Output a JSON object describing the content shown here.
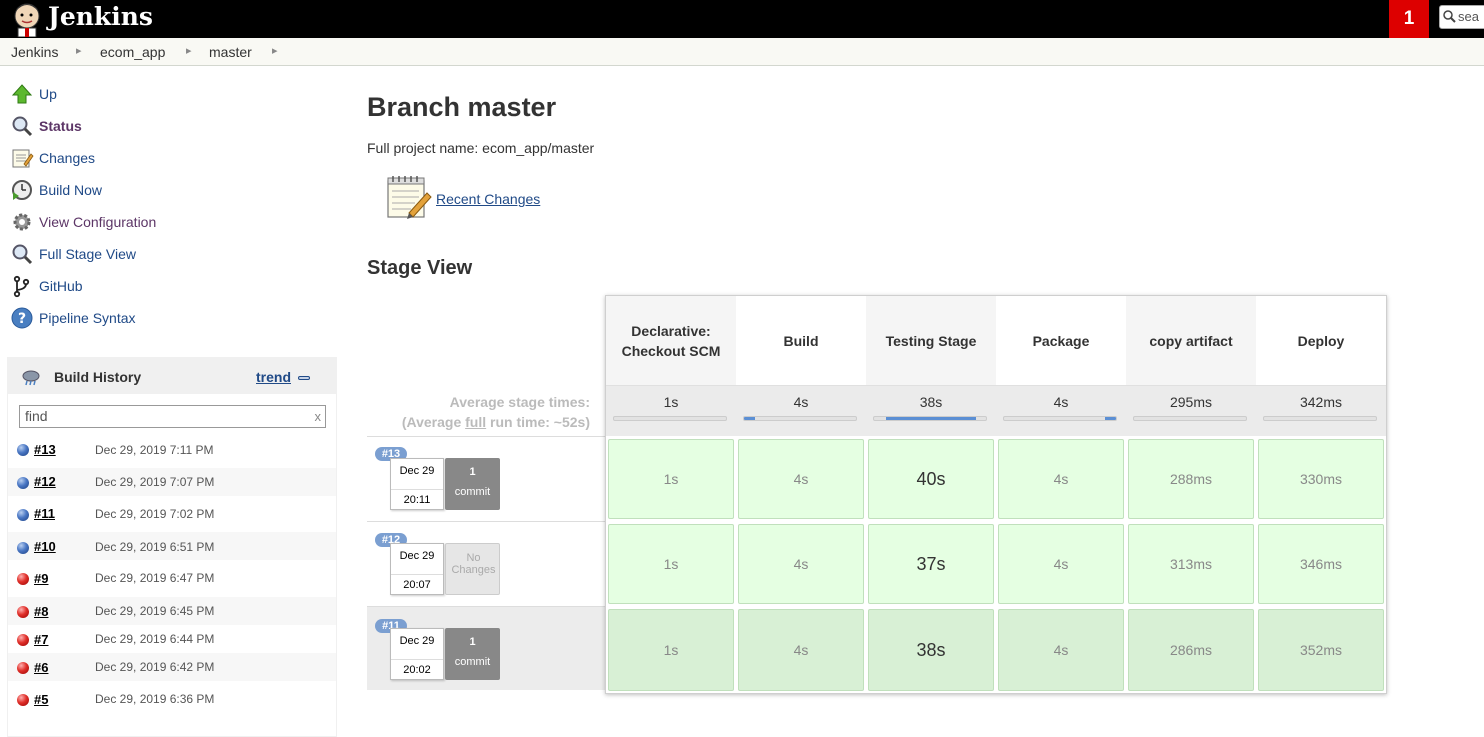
{
  "header": {
    "brand": "Jenkins",
    "notification_count": "1",
    "search_placeholder": "sea"
  },
  "breadcrumb": [
    "Jenkins",
    "ecom_app",
    "master"
  ],
  "sidebar": {
    "tasks": [
      {
        "label": "Up",
        "icon": "up-arrow-icon"
      },
      {
        "label": "Status",
        "icon": "magnifier-icon"
      },
      {
        "label": "Changes",
        "icon": "notepad-icon"
      },
      {
        "label": "Build Now",
        "icon": "clock-play-icon"
      },
      {
        "label": "View Configuration",
        "icon": "gear-icon"
      },
      {
        "label": "Full Stage View",
        "icon": "magnifier-icon"
      },
      {
        "label": "GitHub",
        "icon": "branch-icon"
      },
      {
        "label": "Pipeline Syntax",
        "icon": "help-icon"
      }
    ]
  },
  "build_history": {
    "title": "Build History",
    "trend": "trend",
    "find_placeholder": "find",
    "clear": "x",
    "rows": [
      {
        "num": "#13",
        "date": "Dec 29, 2019 7:11 PM",
        "status": "blue"
      },
      {
        "num": "#12",
        "date": "Dec 29, 2019 7:07 PM",
        "status": "blue"
      },
      {
        "num": "#11",
        "date": "Dec 29, 2019 7:02 PM",
        "status": "blue"
      },
      {
        "num": "#10",
        "date": "Dec 29, 2019 6:51 PM",
        "status": "blue"
      },
      {
        "num": "#9",
        "date": "Dec 29, 2019 6:47 PM",
        "status": "red"
      },
      {
        "num": "#8",
        "date": "Dec 29, 2019 6:45 PM",
        "status": "red"
      },
      {
        "num": "#7",
        "date": "Dec 29, 2019 6:44 PM",
        "status": "red"
      },
      {
        "num": "#6",
        "date": "Dec 29, 2019 6:42 PM",
        "status": "red"
      },
      {
        "num": "#5",
        "date": "Dec 29, 2019 6:36 PM",
        "status": "red"
      }
    ]
  },
  "main": {
    "title": "Branch master",
    "full_name": "Full project name: ecom_app/master",
    "recent_changes": "Recent Changes",
    "stage_view_title": "Stage View"
  },
  "stage_view": {
    "avg_label_1": "Average stage times:",
    "avg_label_2a": "(Average ",
    "avg_label_2b": "full",
    "avg_label_2c": " run time: ~52s)",
    "stages": [
      {
        "name": "Declarative: Checkout SCM",
        "avg": "1s",
        "avg_fraction": 0.0
      },
      {
        "name": "Build",
        "avg": "4s",
        "avg_fraction": 0.1
      },
      {
        "name": "Testing Stage",
        "avg": "38s",
        "avg_fraction": 0.8
      },
      {
        "name": "Package",
        "avg": "4s",
        "avg_fraction": 0.1
      },
      {
        "name": "copy artifact",
        "avg": "295ms",
        "avg_fraction": 0.0
      },
      {
        "name": "Deploy",
        "avg": "342ms",
        "avg_fraction": 0.0
      }
    ],
    "builds": [
      {
        "badge": "#13",
        "date": "Dec 29",
        "time": "20:11",
        "commit_count": "1",
        "commit_label": "commit",
        "no_changes": false,
        "durations": [
          "1s",
          "4s",
          "40s",
          "4s",
          "288ms",
          "330ms"
        ]
      },
      {
        "badge": "#12",
        "date": "Dec 29",
        "time": "20:07",
        "commit_count": "No",
        "commit_label": "Changes",
        "no_changes": true,
        "durations": [
          "1s",
          "4s",
          "37s",
          "4s",
          "313ms",
          "346ms"
        ]
      },
      {
        "badge": "#11",
        "date": "Dec 29",
        "time": "20:02",
        "commit_count": "1",
        "commit_label": "commit",
        "no_changes": false,
        "durations": [
          "1s",
          "4s",
          "38s",
          "4s",
          "286ms",
          "352ms"
        ]
      }
    ]
  },
  "colors": {
    "link": "#204a87",
    "stage_success": "#e5ffe2",
    "alert": "#dd0000"
  }
}
